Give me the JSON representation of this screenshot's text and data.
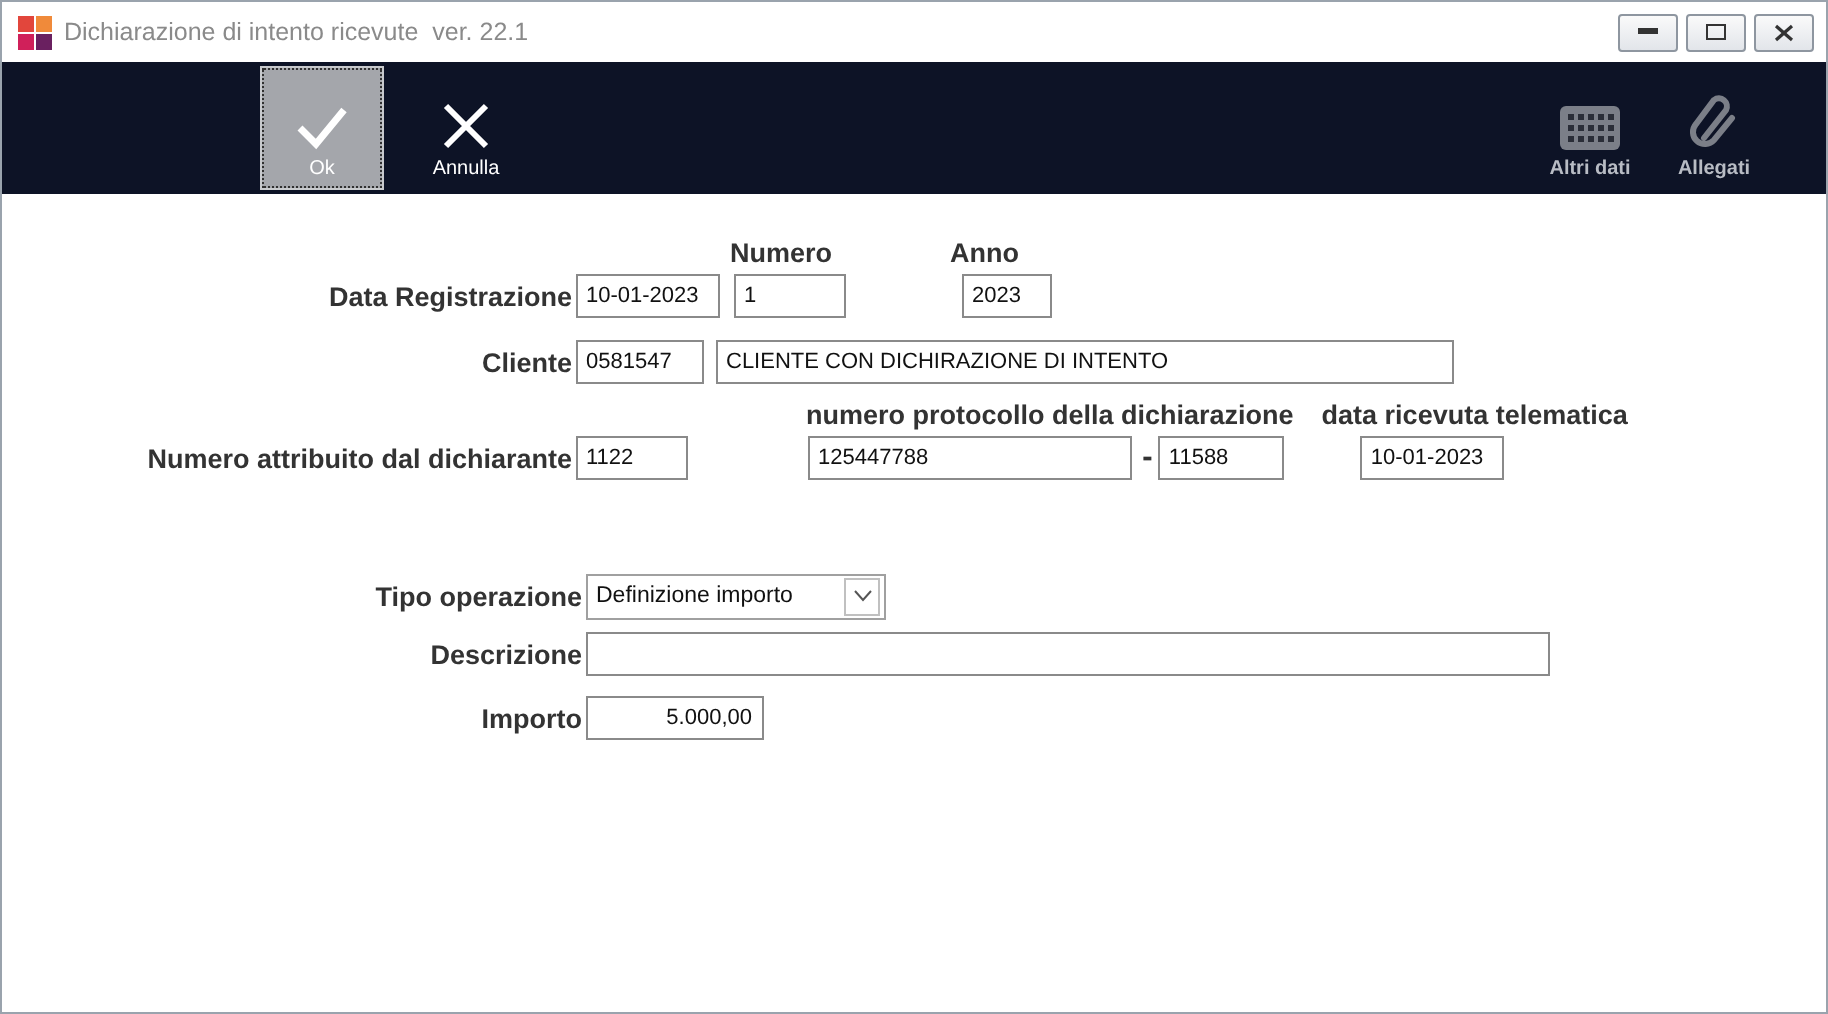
{
  "window": {
    "title": "Dichiarazione di intento ricevute  ver. 22.1"
  },
  "toolbar": {
    "buttons": [
      {
        "label": "Ok",
        "kind": "check",
        "selected": true,
        "disabled": false
      },
      {
        "label": "Annulla",
        "kind": "cross",
        "selected": false,
        "disabled": false
      },
      {
        "label": "Altri dati",
        "kind": "grid",
        "selected": false,
        "disabled": true
      },
      {
        "label": "Allegati",
        "kind": "clip",
        "selected": false,
        "disabled": true
      }
    ]
  },
  "form": {
    "data_registrazione": {
      "label": "Data Registrazione",
      "value": "10-01-2023"
    },
    "numero": {
      "label": "Numero",
      "value": "1"
    },
    "anno": {
      "label": "Anno",
      "value": "2023"
    },
    "cliente": {
      "label": "Cliente",
      "code": "0581547",
      "name": "CLIENTE CON DICHIRAZIONE DI INTENTO"
    },
    "numero_attribuito": {
      "label": "Numero attribuito dal dichiarante",
      "value": "1122"
    },
    "protocollo": {
      "label": "numero protocollo della dichiarazione",
      "value": "125447788",
      "separator": "-",
      "suffix": "11588"
    },
    "data_ricevuta": {
      "label": "data ricevuta telematica",
      "value": "10-01-2023"
    },
    "tipo_operazione": {
      "label": "Tipo operazione",
      "value": "Definizione importo"
    },
    "descrizione": {
      "label": "Descrizione"
    },
    "importo": {
      "label": "Importo",
      "value": "5.000,00"
    }
  }
}
